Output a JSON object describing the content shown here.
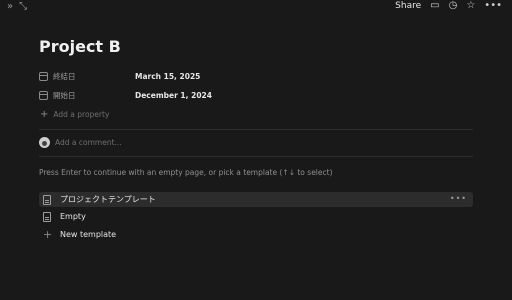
{
  "topbar": {
    "share_label": "Share",
    "icons": [
      "chevrons-right-icon",
      "expand-icon",
      "comment-icon",
      "history-icon",
      "star-icon",
      "more-icon"
    ]
  },
  "page": {
    "title": "Project B"
  },
  "properties": [
    {
      "icon": "calendar-icon",
      "label": "終結日",
      "value": "March 15, 2025"
    },
    {
      "icon": "calendar-icon",
      "label": "開始日",
      "value": "December 1, 2024"
    }
  ],
  "add_property_label": "Add a property",
  "comment": {
    "placeholder": "Add a comment..."
  },
  "hint_text": "Press Enter to continue with an empty page, or pick a template (↑↓ to select)",
  "templates": [
    {
      "icon": "page-icon",
      "label": "プロジェクトテンプレート"
    },
    {
      "icon": "page-icon",
      "label": "Empty"
    },
    {
      "icon": "plus-icon",
      "label": "New template"
    }
  ]
}
